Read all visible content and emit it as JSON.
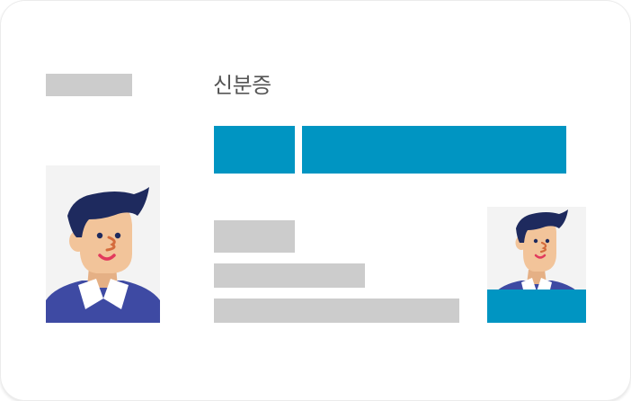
{
  "card": {
    "title": "신분증"
  },
  "colors": {
    "accent": "#0095c2",
    "placeholder_gray": "#cccccc",
    "photo_background": "#f3f3f3",
    "hair": "#1e2a5e",
    "skin": "#f2c49a",
    "shirt": "#3e4aa3",
    "collar": "#ffffff",
    "nose": "#d46b3c",
    "mouth": "#e23a5d"
  },
  "icons": {
    "large_photo": "person-portrait-icon",
    "small_photo": "person-portrait-icon"
  }
}
